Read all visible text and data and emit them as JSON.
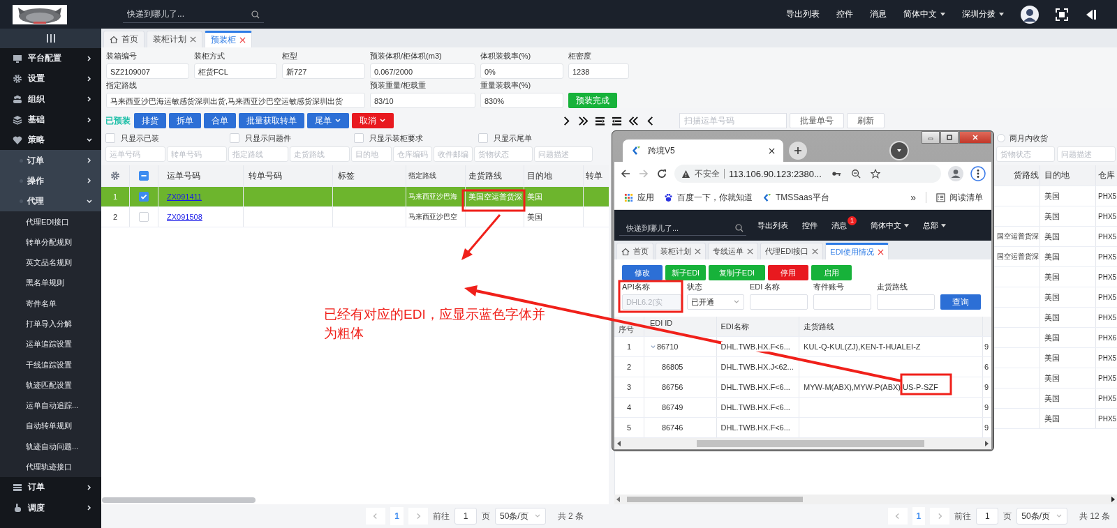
{
  "header": {
    "search": {
      "placeholder": "快递到哪儿了..."
    },
    "menu": [
      {
        "label": "导出列表",
        "dropdown": false
      },
      {
        "label": "控件",
        "dropdown": false
      },
      {
        "label": "消息",
        "dropdown": false
      },
      {
        "label": "简体中文",
        "dropdown": true
      },
      {
        "label": "深圳分拨",
        "dropdown": true
      }
    ]
  },
  "sidebar": {
    "items": [
      {
        "label": "平台配置",
        "expanded": false
      },
      {
        "label": "设置",
        "expanded": false
      },
      {
        "label": "组织",
        "expanded": false
      },
      {
        "label": "基础",
        "expanded": false
      },
      {
        "label": "策略",
        "expanded": true,
        "children": [
          {
            "label": "订单",
            "expanded": false
          },
          {
            "label": "操作",
            "expanded": false
          },
          {
            "label": "代理",
            "expanded": true,
            "children": [
              {
                "label": "代理EDI接口"
              },
              {
                "label": "转单分配规则"
              },
              {
                "label": "英文品名规则"
              },
              {
                "label": "黑名单规则"
              },
              {
                "label": "寄件名单"
              },
              {
                "label": "打单导入分解"
              },
              {
                "label": "运单追踪设置"
              },
              {
                "label": "干线追踪设置"
              },
              {
                "label": "轨迹匹配设置"
              },
              {
                "label": "运单自动追踪..."
              },
              {
                "label": "自动转单规则"
              },
              {
                "label": "轨迹自动问题..."
              },
              {
                "label": "代理轨迹接口"
              }
            ]
          }
        ]
      },
      {
        "label": "订单",
        "expanded": false
      },
      {
        "label": "调度",
        "expanded": false
      }
    ]
  },
  "tabs": [
    {
      "label": "首页",
      "kind": "home",
      "selected": false
    },
    {
      "label": "装柜计划",
      "kind": "page",
      "selected": false
    },
    {
      "label": "预装柜",
      "kind": "page",
      "selected": true
    }
  ],
  "form": {
    "fields": [
      {
        "label": "装箱编号",
        "value": "SZ2109007"
      },
      {
        "label": "装柜方式",
        "value": "柜货FCL"
      },
      {
        "label": "柜型",
        "value": "新727"
      },
      {
        "label": "预装体积/柜体积(m3)",
        "value": "0.067/2000"
      },
      {
        "label": "体积装载率(%)",
        "value": "0%"
      },
      {
        "label": "柜密度",
        "value": "1238"
      },
      {
        "label": "指定路线",
        "value": "马来西亚沙巴海运敏感货深圳出货,马来西亚沙巴空运敏感货深圳出货"
      },
      {
        "label": "预装重量/柜载重",
        "value": "83/10"
      },
      {
        "label": "重量装载率(%)",
        "value": "830%"
      }
    ],
    "submit": "预装完成"
  },
  "toolbar": {
    "status": "已预装",
    "buttons": [
      {
        "label": "排货",
        "kind": "primary",
        "dropdown": false
      },
      {
        "label": "拆单",
        "kind": "primary",
        "dropdown": false
      },
      {
        "label": "合单",
        "kind": "primary",
        "dropdown": false
      },
      {
        "label": "批量获取转单",
        "kind": "primary",
        "dropdown": false
      },
      {
        "label": "尾单",
        "kind": "primary",
        "dropdown": true
      },
      {
        "label": "取消",
        "kind": "danger",
        "dropdown": true
      }
    ]
  },
  "checkboxes": [
    {
      "label": "只显示已装",
      "checked": false
    },
    {
      "label": "只显示问题件",
      "checked": false
    },
    {
      "label": "只显示装柜要求",
      "checked": false
    },
    {
      "label": "只显示尾单",
      "checked": false
    }
  ],
  "filters": [
    {
      "placeholder": "运单号码"
    },
    {
      "placeholder": "转单号码"
    },
    {
      "placeholder": "指定路线"
    },
    {
      "placeholder": "走货路线"
    },
    {
      "placeholder": "目的地"
    },
    {
      "placeholder": "仓库编码"
    },
    {
      "placeholder": "收件邮编"
    },
    {
      "placeholder": "货物状态"
    },
    {
      "placeholder": "问题描述"
    }
  ],
  "table": {
    "header_checkbox": {
      "indeterminate": true
    },
    "columns": [
      "运单号码",
      "转单号码",
      "标签",
      "指定路线",
      "走货路线",
      "目的地",
      "转单"
    ],
    "rows": [
      {
        "index": "1",
        "selected": true,
        "checked": true,
        "waybill": "ZX091411",
        "route": "马来西亚沙巴海",
        "ship_route": "美国空运普货深",
        "destination": "美国"
      },
      {
        "index": "2",
        "selected": false,
        "checked": false,
        "waybill": "ZX091508",
        "route": "马来西亚沙巴空",
        "destination": "美国"
      }
    ]
  },
  "pagination": {
    "page": "1",
    "goto_label": "前往",
    "goto": "1",
    "goto_unit": "页",
    "page_size": "50条/页",
    "total": "共 2 条"
  },
  "right_panel": {
    "scan": {
      "placeholder": "扫描运单号码"
    },
    "buttons": [
      "批量单号",
      "刷新"
    ],
    "radio": {
      "label": "两月内收货",
      "selected": false
    },
    "filters": [
      {
        "placeholder": "货物状态"
      },
      {
        "placeholder": "问题描述"
      }
    ],
    "columns": [
      "货路线",
      "目的地",
      "仓库"
    ],
    "rows": [
      {
        "destination": "美国",
        "warehouse": "PHX5"
      },
      {
        "destination": "美国",
        "warehouse": "PHX5"
      },
      {
        "ship_route": "国空运普货深",
        "destination": "美国",
        "warehouse": "PHX5"
      },
      {
        "ship_route": "国空运普货深",
        "destination": "美国",
        "warehouse": "PHX5"
      },
      {
        "destination": "美国",
        "warehouse": "PHX5"
      },
      {
        "destination": "美国",
        "warehouse": "PHX5"
      },
      {
        "destination": "美国",
        "warehouse": "PHX5"
      },
      {
        "destination": "美国",
        "warehouse": "PHX6"
      },
      {
        "destination": "美国",
        "warehouse": "PHX5"
      },
      {
        "destination": "美国",
        "warehouse": "PHX5"
      },
      {
        "destination": "美国",
        "warehouse": "PHX5"
      },
      {
        "destination": "美国",
        "warehouse": "PHX5"
      }
    ],
    "pagination": {
      "page": "1",
      "goto_label": "前往",
      "goto": "1",
      "goto_unit": "页",
      "page_size": "50条/页",
      "total": "共 12 条"
    }
  },
  "popup": {
    "browser": {
      "tab": "跨境V5",
      "security": "不安全",
      "url": "113.106.90.123:2380...",
      "bookmarks": [
        {
          "label": "应用"
        },
        {
          "label": "百度一下，你就知道"
        },
        {
          "label": "TMSSaas平台"
        }
      ],
      "more": "»",
      "reading_list": "阅读清单"
    },
    "app": {
      "search": {
        "placeholder": "快递到哪儿了..."
      },
      "menu": [
        {
          "label": "导出列表",
          "dropdown": false
        },
        {
          "label": "控件",
          "dropdown": false
        },
        {
          "label": "消息",
          "dropdown": false,
          "badge": "1"
        },
        {
          "label": "简体中文",
          "dropdown": true
        },
        {
          "label": "总部",
          "dropdown": true
        }
      ],
      "tabs": [
        {
          "label": "首页",
          "kind": "home",
          "selected": false
        },
        {
          "label": "装柜计划",
          "kind": "page",
          "selected": false
        },
        {
          "label": "专线运单",
          "kind": "page",
          "selected": false
        },
        {
          "label": "代理EDI接口",
          "kind": "page",
          "selected": false
        },
        {
          "label": "EDI使用情况",
          "kind": "page",
          "selected": true
        }
      ],
      "buttons": [
        {
          "label": "修改",
          "kind": "primary"
        },
        {
          "label": "新子EDI",
          "kind": "success"
        },
        {
          "label": "复制子EDI",
          "kind": "success"
        },
        {
          "label": "停用",
          "kind": "danger"
        },
        {
          "label": "启用",
          "kind": "success"
        }
      ],
      "filters": [
        {
          "label": "API名称",
          "kind": "input",
          "value": "DHL6.2(实",
          "disabled": true
        },
        {
          "label": "状态",
          "kind": "select",
          "value": "已开通"
        },
        {
          "label": "EDI 名称",
          "kind": "input"
        },
        {
          "label": "寄件账号",
          "kind": "input"
        },
        {
          "label": "走货路线",
          "kind": "input"
        }
      ],
      "search_button": "查询",
      "table": {
        "columns": [
          "序号",
          "EDI ID",
          "EDI名称",
          "走货路线"
        ],
        "rows": [
          {
            "no": "1",
            "edi_id": "86710",
            "name": "DHL.TWB.HX.F<6...",
            "route": "KUL-Q-KUL(ZJ),KEN-T-HUALEI-Z",
            "column_5": "9",
            "expanded": true,
            "children": [
              {
                "no": "2",
                "edi_id": "86805",
                "name": "DHL.TWB.HX.J<62...",
                "column_5": "6"
              },
              {
                "no": "3",
                "edi_id": "86756",
                "name": "DHL.TWB.HX.F<6...",
                "route": "MYW-M(ABX),MYW-P(ABX),US-P-SZF",
                "column_5": "9"
              },
              {
                "no": "4",
                "edi_id": "86749",
                "name": "DHL.TWB.HX.F<6...",
                "column_5": "9"
              },
              {
                "no": "5",
                "edi_id": "86746",
                "name": "DHL.TWB.HX.F<6...",
                "column_5": "9"
              }
            ]
          }
        ]
      }
    }
  },
  "annotation": {
    "note": "已经有对应的EDI，应显示蓝色字体并为粗体"
  }
}
